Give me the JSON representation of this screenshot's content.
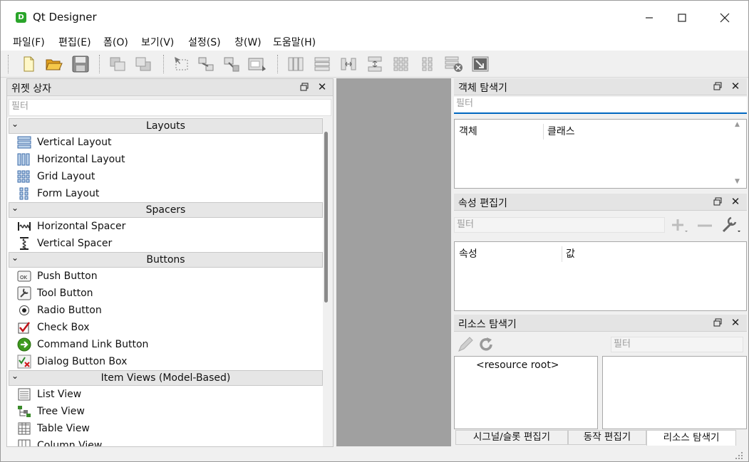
{
  "window": {
    "title": "Qt Designer",
    "app_icon_letter": "D"
  },
  "menu": [
    "파일(F)",
    "편집(E)",
    "폼(O)",
    "보기(V)",
    "설정(S)",
    "창(W)",
    "도움말(H)"
  ],
  "widget_box": {
    "title": "위젯 상자",
    "filter_placeholder": "필터",
    "categories": {
      "layouts": "Layouts",
      "spacers": "Spacers",
      "buttons": "Buttons",
      "item_views": "Item Views (Model-Based)"
    },
    "items": {
      "vertical_layout": "Vertical Layout",
      "horizontal_layout": "Horizontal Layout",
      "grid_layout": "Grid Layout",
      "form_layout": "Form Layout",
      "horizontal_spacer": "Horizontal Spacer",
      "vertical_spacer": "Vertical Spacer",
      "push_button": "Push Button",
      "tool_button": "Tool Button",
      "radio_button": "Radio Button",
      "check_box": "Check Box",
      "command_link_button": "Command Link Button",
      "dialog_button_box": "Dialog Button Box",
      "list_view": "List View",
      "tree_view": "Tree View",
      "table_view": "Table View",
      "column_view": "Column View"
    }
  },
  "object_inspector": {
    "title": "객체 탐색기",
    "filter_placeholder": "필터",
    "col_object": "객체",
    "col_class": "클래스"
  },
  "property_editor": {
    "title": "속성 편집기",
    "filter_placeholder": "필터",
    "col_property": "속성",
    "col_value": "값"
  },
  "resource_browser": {
    "title": "리소스 탐색기",
    "filter_placeholder": "필터",
    "root": "<resource root>"
  },
  "bottom_tabs": [
    "시그널/슬롯 편집기",
    "동작 편집기",
    "리소스 탐색기"
  ],
  "colors": {
    "accent": "#0067c0",
    "workspace": "#a0a0a0",
    "icon_green": "#2aa52a"
  }
}
